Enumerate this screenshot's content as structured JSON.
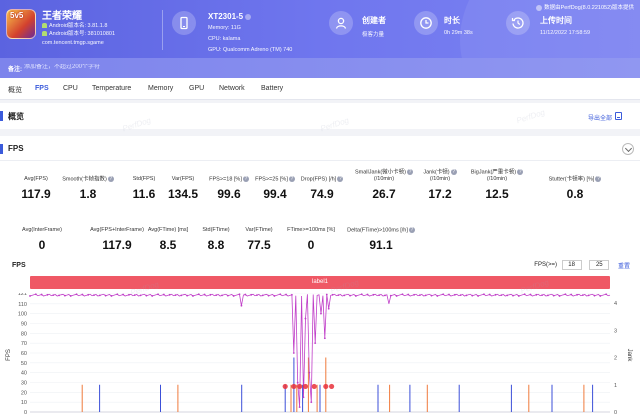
{
  "app": {
    "name": "王者荣耀",
    "icon_text": "5v5",
    "android_version": "Android版本名: 3.81.1.8",
    "android_code": "Android版本号: 381010801",
    "package": "com.tencent.tmgp.sgame"
  },
  "device": {
    "model": "XT2301-5",
    "memory": "Memory: 11G",
    "cpu": "CPU: kalama",
    "gpu": "GPU: Qualcomm Adreno (TM) 740"
  },
  "creator": {
    "title": "创建者",
    "value": "极客力量"
  },
  "duration": {
    "title": "时长",
    "value": "0h 29m 38s"
  },
  "upload": {
    "title": "上传时间",
    "value": "11/12/2022 17:58:59"
  },
  "data_source": "数据由PerfDog(8.0.221052)版本提供",
  "notes": {
    "label": "备注:",
    "placeholder": "添加备注，不超过200个字符"
  },
  "tabs": [
    "概览",
    "FPS",
    "CPU",
    "Temperature",
    "Memory",
    "GPU",
    "Network",
    "Battery"
  ],
  "overview": {
    "title": "概览",
    "export": "导出全部"
  },
  "fps_section": {
    "title": "FPS"
  },
  "metrics_row1": [
    {
      "label": "Avg(FPS)",
      "value": "117.9",
      "help": false
    },
    {
      "label": "Smooth(卡帧指数)",
      "value": "1.8",
      "help": true
    },
    {
      "label": "Std(FPS)",
      "value": "11.6",
      "help": false
    },
    {
      "label": "Var(FPS)",
      "value": "134.5",
      "help": false
    },
    {
      "label": "FPS>=18 [%]",
      "value": "99.6",
      "help": true
    },
    {
      "label": "FPS>=25 [%]",
      "value": "99.4",
      "help": true
    },
    {
      "label": "Drop(FPS) [/h]",
      "value": "74.9",
      "help": true
    },
    {
      "label": "SmallJank(微小卡顿)\n(/10min)",
      "value": "26.7",
      "help": true
    },
    {
      "label": "Jank(卡顿)\n(/10min)",
      "value": "17.2",
      "help": true
    },
    {
      "label": "BigJank(严重卡顿)\n(/10min)",
      "value": "12.5",
      "help": true
    },
    {
      "label": "Stutter(卡顿率) [%]",
      "value": "0.8",
      "help": true
    }
  ],
  "metrics_row2": [
    {
      "label": "Avg(InterFrame)",
      "value": "0",
      "help": false
    },
    {
      "label": "Avg(FPS+InterFrame)",
      "value": "117.9",
      "help": false
    },
    {
      "label": "Avg(FTime) [ms]",
      "value": "8.5",
      "help": false
    },
    {
      "label": "Std(FTime)",
      "value": "8.8",
      "help": false
    },
    {
      "label": "Var(FTime)",
      "value": "77.5",
      "help": false
    },
    {
      "label": "FTime>=100ms [%]",
      "value": "0",
      "help": false
    },
    {
      "label": "Delta(FTime)>100ms [/h]",
      "value": "91.1",
      "help": true
    }
  ],
  "chart_header": {
    "title": "FPS",
    "cfg_label": "FPS(>=)",
    "threshold_a": "18",
    "threshold_b": "25",
    "reset": "重置",
    "label_band": "label1"
  },
  "watermark": "PerfDog",
  "colors": {
    "header": "#5b63e0",
    "accent": "#3b5bdb",
    "fps_line": "#c03ec8",
    "label_band": "#ef5865",
    "jank_blue": "#3b4fd8",
    "jank_orange": "#f07a3c",
    "bigjank_red": "#e8303a"
  },
  "chart_data": {
    "type": "line",
    "ylabel": "FPS",
    "ylabel_right": "Jank",
    "yticks_left": [
      0,
      10,
      20,
      30,
      40,
      50,
      60,
      70,
      80,
      90,
      100,
      110,
      121
    ],
    "yticks_right": [
      0,
      1,
      2,
      3,
      4
    ],
    "ylim": [
      0,
      121
    ],
    "ylim_right": [
      0,
      4
    ],
    "n_points": 300,
    "baseline_fps": 119,
    "fps_dips": [
      {
        "pos": 0.455,
        "value": 60
      },
      {
        "pos": 0.46,
        "value": 30
      },
      {
        "pos": 0.465,
        "value": 5
      },
      {
        "pos": 0.47,
        "value": 15
      },
      {
        "pos": 0.475,
        "value": 95
      },
      {
        "pos": 0.48,
        "value": 40
      },
      {
        "pos": 0.485,
        "value": 10
      },
      {
        "pos": 0.49,
        "value": 70
      },
      {
        "pos": 0.5,
        "value": 100
      },
      {
        "pos": 0.51,
        "value": 75
      },
      {
        "pos": 0.515,
        "value": 105
      },
      {
        "pos": 0.365,
        "value": 108
      },
      {
        "pos": 0.62,
        "value": 110
      }
    ],
    "jank_series": [
      {
        "name": "Jank",
        "color": "#3b4fd8",
        "points": [
          [
            0.12,
            1
          ],
          [
            0.225,
            1
          ],
          [
            0.365,
            1
          ],
          [
            0.44,
            1
          ],
          [
            0.455,
            2
          ],
          [
            0.47,
            1
          ],
          [
            0.5,
            1
          ],
          [
            0.6,
            1
          ],
          [
            0.655,
            1
          ],
          [
            0.74,
            1
          ],
          [
            0.83,
            1
          ],
          [
            0.9,
            1
          ],
          [
            0.97,
            1
          ]
        ]
      },
      {
        "name": "BigJank",
        "color": "#f07a3c",
        "points": [
          [
            0.09,
            1
          ],
          [
            0.255,
            1
          ],
          [
            0.45,
            1
          ],
          [
            0.46,
            1
          ],
          [
            0.48,
            2
          ],
          [
            0.495,
            1
          ],
          [
            0.51,
            2
          ],
          [
            0.62,
            1
          ],
          [
            0.685,
            1
          ],
          [
            0.86,
            1
          ],
          [
            0.955,
            1
          ]
        ]
      }
    ],
    "jank_markers": [
      0.44,
      0.455,
      0.465,
      0.475,
      0.49,
      0.51,
      0.52
    ]
  }
}
